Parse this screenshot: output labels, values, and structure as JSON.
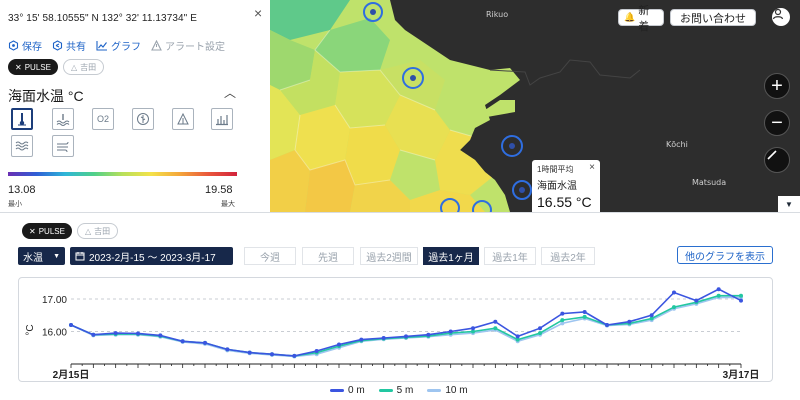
{
  "panel": {
    "coords": "33° 15' 58.10555\" N 132° 32' 11.13734\" E",
    "close": "×",
    "actions": [
      {
        "label": "保存",
        "icon": "save-icon",
        "disabled": false
      },
      {
        "label": "共有",
        "icon": "share-icon",
        "disabled": false
      },
      {
        "label": "グラフ",
        "icon": "graph-icon",
        "disabled": false
      },
      {
        "label": "アラート設定",
        "icon": "alert-icon",
        "disabled": true
      }
    ],
    "pills": [
      {
        "label": "PULSE",
        "active": true
      },
      {
        "label": "吉田",
        "active": false
      }
    ],
    "param_title": "海面水温  °C",
    "param_icons": [
      "thermometer-icon",
      "wave-temp-icon",
      "oxygen-icon",
      "leaf-icon",
      "tent-icon",
      "bar-graph-icon",
      "waves-icon",
      "wind-icon"
    ],
    "scale": {
      "min": "13.08",
      "max": "19.58",
      "min_label": "最小",
      "max_label": "最大"
    }
  },
  "map": {
    "buttons": {
      "news": "新着",
      "contact": "お問い合わせ"
    },
    "labels": [
      {
        "text": "Rikuo"
      },
      {
        "text": "Kōchi"
      },
      {
        "text": "Matsuda"
      }
    ],
    "popup": {
      "title": "1時間平均",
      "param": "海面水温",
      "value": "16.55 °C",
      "close": "×"
    },
    "zoom_in": "+",
    "zoom_out": "−"
  },
  "bottom": {
    "pills": [
      {
        "label": "PULSE",
        "active": true
      },
      {
        "label": "吉田",
        "active": false
      }
    ],
    "param_select": "水温",
    "date_range": "2023-2月-15 ～ 2023-3月-17",
    "periods": [
      {
        "label": "今週",
        "active": false
      },
      {
        "label": "先週",
        "active": false
      },
      {
        "label": "過去2週間",
        "active": false
      },
      {
        "label": "過去1ヶ月",
        "active": true
      },
      {
        "label": "過去1年",
        "active": false
      },
      {
        "label": "過去2年",
        "active": false
      }
    ],
    "other_graph": "他のグラフを表示"
  },
  "chart_data": {
    "type": "line",
    "ylabel": "°C",
    "ylim": [
      15.0,
      17.4
    ],
    "yticks": [
      16.0,
      17.0
    ],
    "ytick_labels": [
      "16.00",
      "17.00"
    ],
    "xtick_labels": [
      "2月15日",
      "3月17日"
    ],
    "x": [
      0,
      1,
      2,
      3,
      4,
      5,
      6,
      7,
      8,
      9,
      10,
      11,
      12,
      13,
      14,
      15,
      16,
      17,
      18,
      19,
      20,
      21,
      22,
      23,
      24,
      25,
      26,
      27,
      28,
      29,
      30
    ],
    "series": [
      {
        "name": "0 m",
        "color": "#3b55e0",
        "values": [
          16.2,
          15.9,
          15.95,
          15.94,
          15.88,
          15.7,
          15.65,
          15.45,
          15.35,
          15.3,
          15.25,
          15.4,
          15.6,
          15.75,
          15.8,
          15.85,
          15.9,
          16.0,
          16.1,
          16.3,
          15.85,
          16.1,
          16.55,
          16.6,
          16.2,
          16.3,
          16.5,
          17.2,
          16.95,
          17.3,
          16.95
        ]
      },
      {
        "name": "5 m",
        "color": "#22c7a1",
        "values": [
          16.2,
          15.9,
          15.92,
          15.92,
          15.86,
          15.7,
          15.65,
          15.45,
          15.35,
          15.3,
          15.25,
          15.35,
          15.55,
          15.72,
          15.78,
          15.82,
          15.86,
          15.95,
          16.0,
          16.1,
          15.75,
          15.95,
          16.35,
          16.45,
          16.2,
          16.25,
          16.4,
          16.75,
          16.9,
          17.1,
          17.1
        ]
      },
      {
        "name": "10 m",
        "color": "#9ec5f0",
        "values": [
          16.2,
          15.88,
          15.9,
          15.9,
          15.84,
          15.68,
          15.62,
          15.42,
          15.33,
          15.28,
          15.23,
          15.3,
          15.5,
          15.7,
          15.76,
          15.8,
          15.84,
          15.9,
          15.95,
          16.05,
          15.7,
          15.9,
          16.25,
          16.4,
          16.18,
          16.22,
          16.35,
          16.7,
          16.85,
          17.05,
          17.05
        ]
      }
    ]
  }
}
